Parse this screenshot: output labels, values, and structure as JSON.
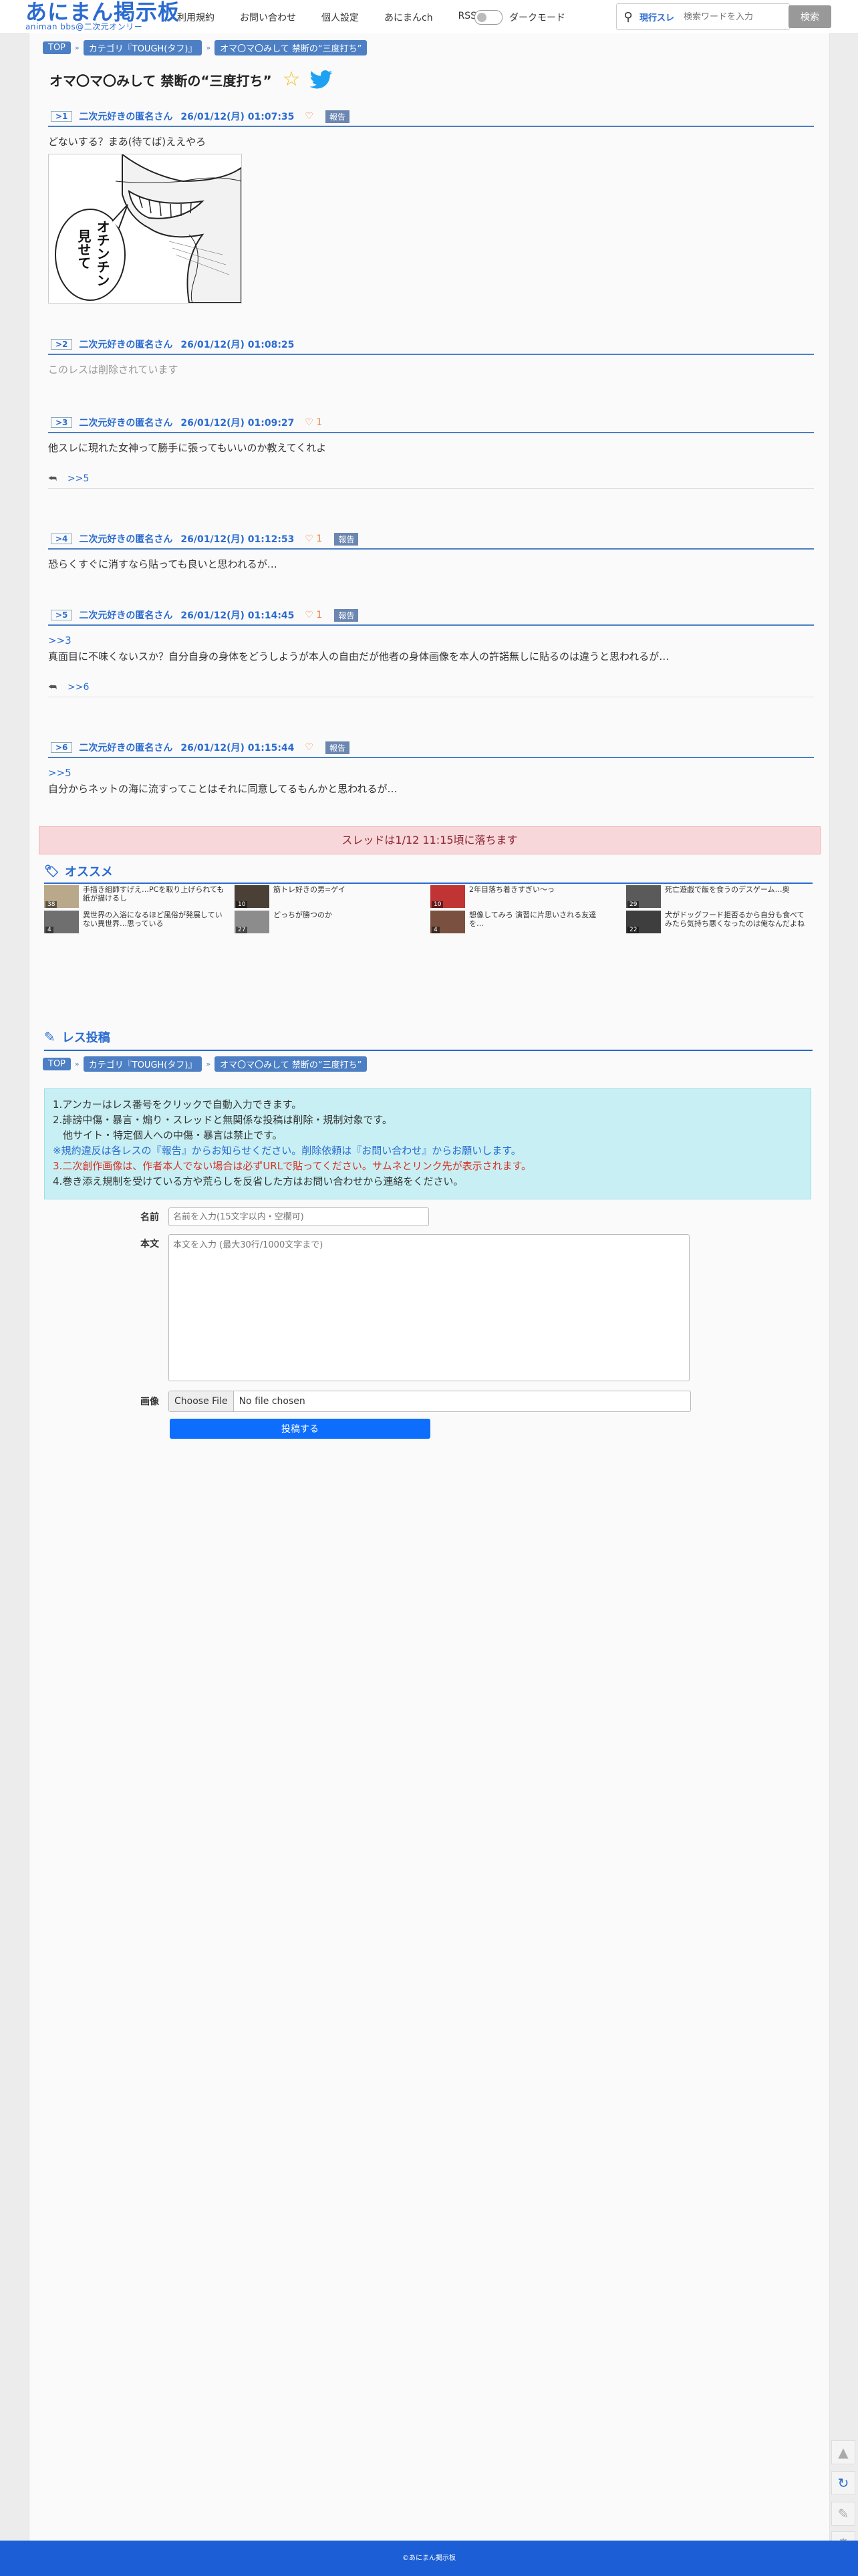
{
  "header": {
    "logo_main": "あにまん掲示板",
    "logo_sub": "animan bbs@二次元オンリー",
    "nav": [
      "利用規約",
      "お問い合わせ",
      "個人設定",
      "あにまんch",
      "RSS"
    ],
    "dark_mode_label": "ダークモード",
    "search_scope": "現行スレ",
    "search_placeholder": "検索ワードを入力",
    "search_button": "検索"
  },
  "breadcrumb": [
    "TOP",
    "カテゴリ『TOUGH(タフ)』",
    "オマ〇マ〇みして 禁断の“三度打ち”"
  ],
  "thread": {
    "title": "オマ〇マ〇みして 禁断の“三度打ち”",
    "favorited": false
  },
  "posts": [
    {
      "num": "1",
      "name": "二次元好きの匿名さん",
      "date": "26/01/12(月) 01:07:35",
      "likes": "",
      "report": "報告",
      "anchor": "",
      "text": "どないする？まあ(待てば)ええやろ",
      "image_text": "オチンチン 見せて",
      "reply": ""
    },
    {
      "num": "2",
      "name": "二次元好きの匿名さん",
      "date": "26/01/12(月) 01:08:25",
      "likes": "",
      "report": "",
      "anchor": "",
      "text": "このレスは削除されています",
      "deleted": true,
      "reply": ""
    },
    {
      "num": "3",
      "name": "二次元好きの匿名さん",
      "date": "26/01/12(月) 01:09:27",
      "likes": "1",
      "report": "",
      "anchor": "",
      "text": "他スレに現れた女神って勝手に張ってもいいのか教えてくれよ",
      "reply": ">>5"
    },
    {
      "num": "4",
      "name": "二次元好きの匿名さん",
      "date": "26/01/12(月) 01:12:53",
      "likes": "1",
      "report": "報告",
      "anchor": "",
      "text": "恐らくすぐに消すなら貼っても良いと思われるが…",
      "reply": ""
    },
    {
      "num": "5",
      "name": "二次元好きの匿名さん",
      "date": "26/01/12(月) 01:14:45",
      "likes": "1",
      "report": "報告",
      "anchor": ">>3",
      "text": "真面目に不味くないスか？自分自身の身体をどうしようが本人の自由だが他者の身体画像を本人の許諾無しに貼るのは違うと思われるが…",
      "reply": ">>6"
    },
    {
      "num": "6",
      "name": "二次元好きの匿名さん",
      "date": "26/01/12(月) 01:15:44",
      "likes": "",
      "report": "報告",
      "anchor": ">>5",
      "text": "自分からネットの海に流すってことはそれに同意してるもんかと思われるが…",
      "reply": ""
    }
  ],
  "expire_notice": "スレッドは1/12 11:15頃に落ちます",
  "recommend": {
    "title": "オススメ",
    "items": [
      {
        "text": "手描き組師すげえ…PCを取り上げられても紙が描けるし",
        "count": "38"
      },
      {
        "text": "筋トレ好きの男=ゲイ",
        "count": "10"
      },
      {
        "text": "2年目落ち着きすぎい〜っ",
        "count": "10"
      },
      {
        "text": "死亡遊戯で飯を食うのデスゲーム…奥",
        "count": "29"
      },
      {
        "text": "異世界の入浴になるほど風俗が発展していない異世界…思っている",
        "count": "4"
      },
      {
        "text": "どっちが勝つのか",
        "count": "27"
      },
      {
        "text": "想像してみろ 演習に片思いされる友達を…",
        "count": "4"
      },
      {
        "text": "犬がドッグフード拒否るから自分も食べてみたら気持ち悪くなったのは俺なんだよね",
        "count": "22"
      }
    ]
  },
  "form": {
    "title": "レス投稿",
    "notice": [
      "1.アンカーはレス番号をクリックで自動入力できます。",
      "2.誹謗中傷・暴言・煽り・スレッドと無関係な投稿は削除・規制対象です。",
      "　他サイト・特定個人への中傷・暴言は禁止です。",
      "※規約違反は各レスの『報告』からお知らせください。削除依頼は『お問い合わせ』からお願いします。",
      "3.二次創作画像は、作者本人でない場合は必ずURLで貼ってください。サムネとリンク先が表示されます。",
      "4.巻き添え規制を受けている方や荒らしを反省した方はお問い合わせから連絡をください。"
    ],
    "name_label": "名前",
    "name_placeholder": "名前を入力(15文字以内・空欄可)",
    "body_label": "本文",
    "body_placeholder": "本文を入力 (最大30行/1000文字まで)",
    "image_label": "画像",
    "file_button": "Choose File",
    "file_status": "No file chosen",
    "submit": "投稿する"
  },
  "footer": "©あにまん掲示板"
}
